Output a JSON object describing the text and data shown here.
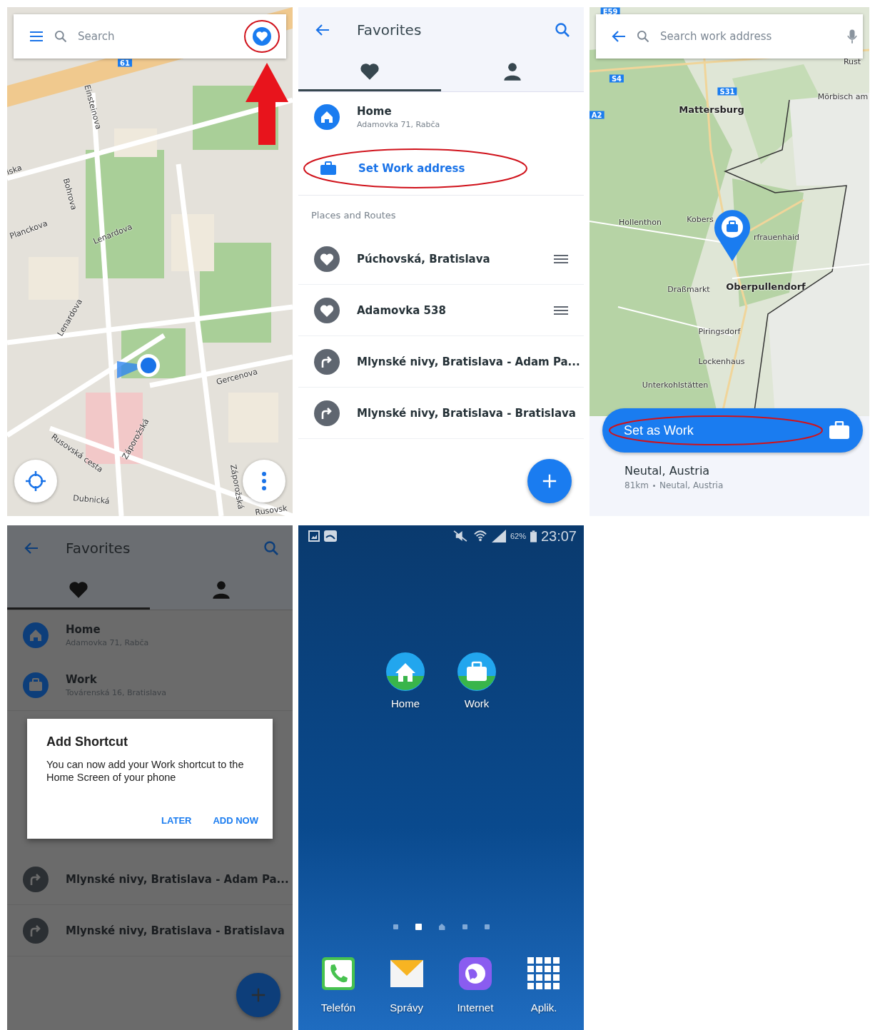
{
  "map_screen": {
    "search": {
      "placeholder": "Search"
    },
    "map_labels": [
      {
        "kind": "badge",
        "text": "61"
      },
      {
        "kind": "street",
        "text": "Einsteinova"
      },
      {
        "kind": "street",
        "text": "iska"
      },
      {
        "kind": "street",
        "text": "Bohrova"
      },
      {
        "kind": "street",
        "text": "Planckova"
      },
      {
        "kind": "street",
        "text": "Lenardova"
      },
      {
        "kind": "street",
        "text": "Lenardova"
      },
      {
        "kind": "street",
        "text": "Gercenova"
      },
      {
        "kind": "street",
        "text": "Záporožská"
      },
      {
        "kind": "street",
        "text": "Rusovská cesta"
      },
      {
        "kind": "street",
        "text": "Záporožská"
      },
      {
        "kind": "street",
        "text": "Dubnická"
      },
      {
        "kind": "street",
        "text": "Rusovsk"
      }
    ]
  },
  "favorites_screen": {
    "title": "Favorites",
    "tabs": [
      {
        "kind": "heart",
        "selected": true
      },
      {
        "kind": "person",
        "selected": false
      }
    ],
    "home": {
      "title": "Home",
      "address": "Adamovka 71, Rabča"
    },
    "set_work": {
      "label": "Set Work address"
    },
    "section_label": "Places and Routes",
    "items": [
      {
        "kind": "place",
        "name": "Púchovská, Bratislava"
      },
      {
        "kind": "place",
        "name": "Adamovka 538"
      },
      {
        "kind": "route",
        "name": "Mlynské nivy, Bratislava - Adam Pa..."
      },
      {
        "kind": "route",
        "name": "Mlynské nivy, Bratislava - Bratislava"
      }
    ]
  },
  "work_search_screen": {
    "search": {
      "placeholder": "Search work address"
    },
    "map_labels": [
      {
        "kind": "badge",
        "text": "E59"
      },
      {
        "kind": "badge",
        "text": "S4"
      },
      {
        "kind": "badge",
        "text": "A2"
      },
      {
        "kind": "badge",
        "text": "S31"
      },
      {
        "kind": "town",
        "text": "Rust"
      },
      {
        "kind": "city",
        "text": "Mattersburg"
      },
      {
        "kind": "town",
        "text": "Mörbisch am"
      },
      {
        "kind": "town",
        "text": "Hollenthon"
      },
      {
        "kind": "town",
        "text": "Kobers"
      },
      {
        "kind": "town",
        "text": "rfrauenhaid"
      },
      {
        "kind": "town",
        "text": "Draßmarkt"
      },
      {
        "kind": "city",
        "text": "Oberpullendorf"
      },
      {
        "kind": "town",
        "text": "Piringsdorf"
      },
      {
        "kind": "town",
        "text": "Lockenhaus"
      },
      {
        "kind": "town",
        "text": "Unterkohlstätten"
      }
    ],
    "action": {
      "label": "Set as Work"
    },
    "result": {
      "title": "Neutal, Austria",
      "distance": "81km",
      "detail": "Neutal, Austria"
    }
  },
  "shortcut_dialog_screen": {
    "title": "Favorites",
    "tabs": [
      {
        "kind": "heart",
        "selected": true
      },
      {
        "kind": "person",
        "selected": false
      }
    ],
    "favorites": [
      {
        "kind": "home",
        "title": "Home",
        "address": "Adamovka 71, Rabča"
      },
      {
        "kind": "work",
        "title": "Work",
        "address": "Továrenská 16, Bratislava"
      }
    ],
    "dialog": {
      "title": "Add Shortcut",
      "message": "You can now add your Work shortcut to the Home Screen of your phone",
      "buttons": [
        "LATER",
        "ADD NOW"
      ]
    },
    "items": [
      {
        "kind": "route",
        "name": "Mlynské nivy, Bratislava - Adam Pa..."
      },
      {
        "kind": "route",
        "name": "Mlynské nivy, Bratislava - Bratislava"
      }
    ]
  },
  "home_screen": {
    "status": {
      "battery": "62%",
      "time": "23:07"
    },
    "shortcuts": [
      {
        "kind": "home",
        "label": "Home"
      },
      {
        "kind": "work",
        "label": "Work"
      }
    ],
    "pages": [
      {
        "kind": "dot",
        "selected": false
      },
      {
        "kind": "dot",
        "selected": true
      },
      {
        "kind": "home",
        "selected": false
      },
      {
        "kind": "dot",
        "selected": false
      },
      {
        "kind": "dot",
        "selected": false
      }
    ],
    "dock": [
      {
        "kind": "phone",
        "label": "Telefón"
      },
      {
        "kind": "messages",
        "label": "Správy"
      },
      {
        "kind": "internet",
        "label": "Internet"
      },
      {
        "kind": "apps",
        "label": "Aplik."
      }
    ]
  }
}
